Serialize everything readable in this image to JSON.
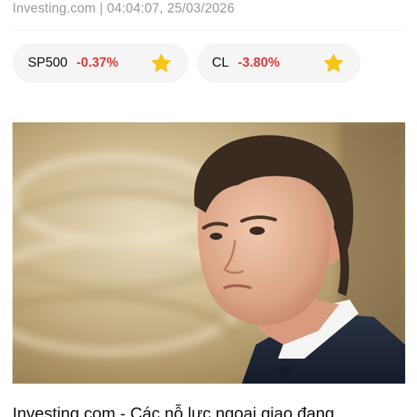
{
  "article": {
    "source_line": "Investing.com | 04:04:07, 25/03/2026",
    "headline_partial": "Investing.com - Các nỗ lực ngoại giao đang"
  },
  "tickers": [
    {
      "symbol": "SP500",
      "change": "-0.37%",
      "icon": "star-icon"
    },
    {
      "symbol": "CL",
      "change": "-3.80%",
      "icon": "star-icon"
    }
  ],
  "colors": {
    "negative": "#e5393b",
    "star": "#f5c518",
    "chip_bg": "#f5f5f6",
    "meta_text": "#9a9a9a"
  }
}
